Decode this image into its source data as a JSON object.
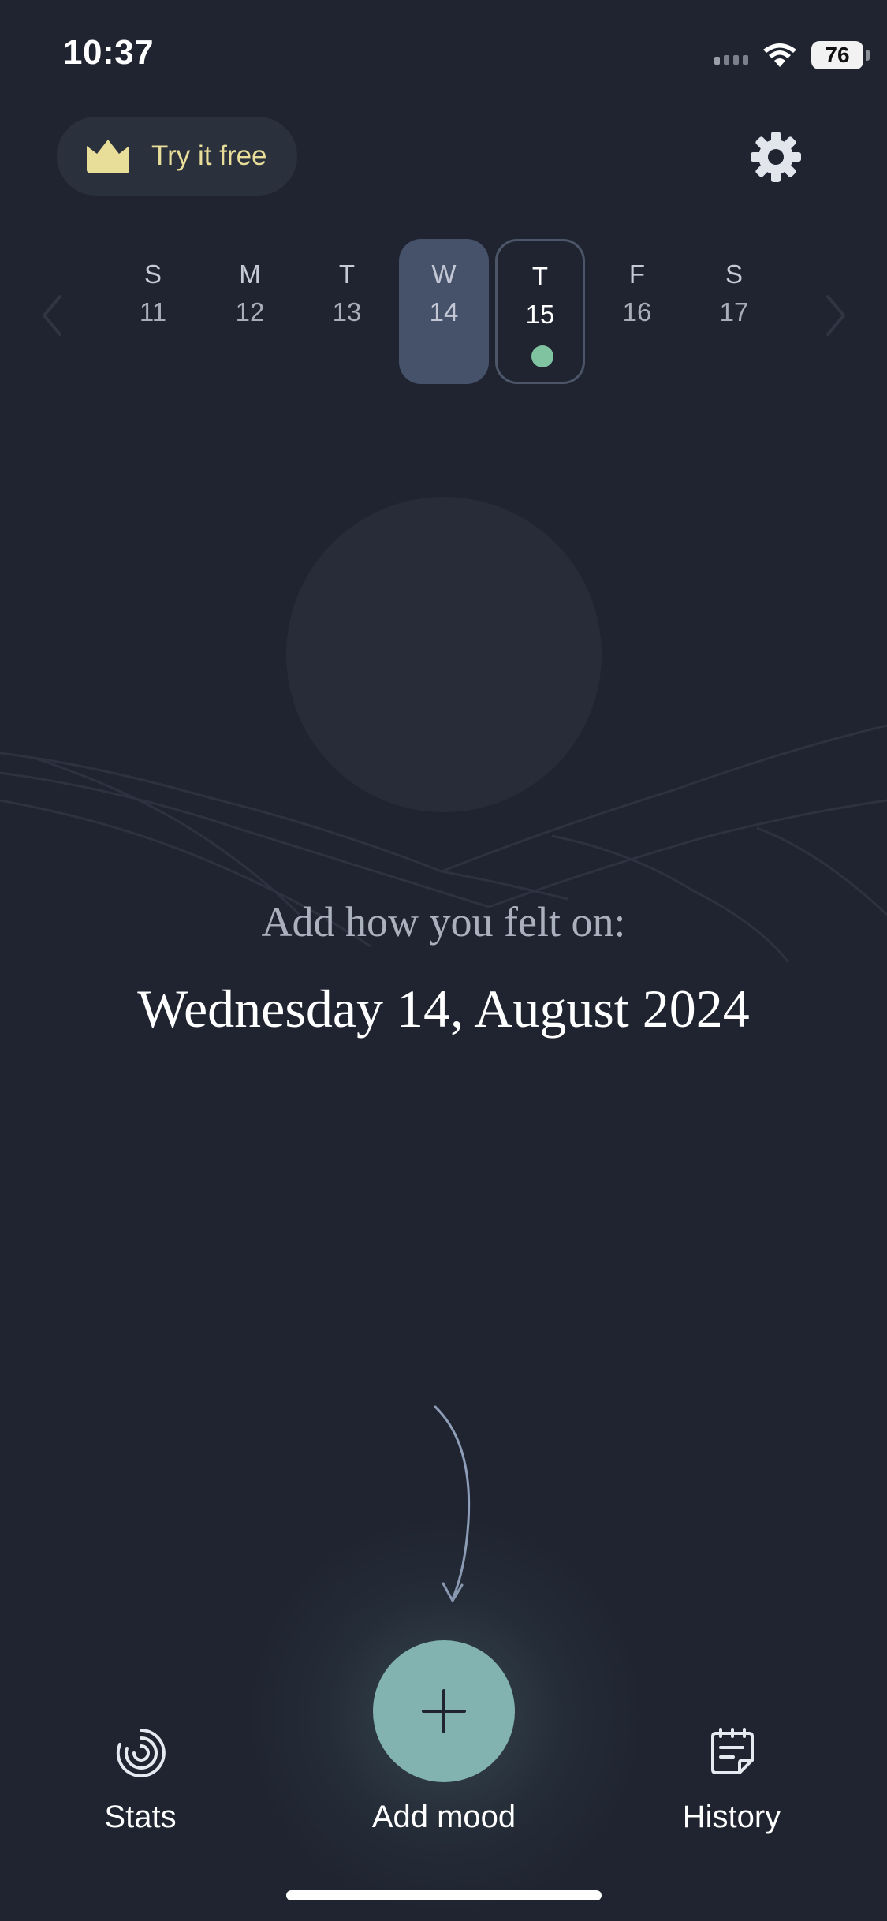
{
  "status_bar": {
    "time": "10:37",
    "battery": "76"
  },
  "header": {
    "promo_label": "Try it free",
    "icons": [
      "crown-icon",
      "gear-icon"
    ]
  },
  "week": {
    "days": [
      {
        "name": "S",
        "num": "11"
      },
      {
        "name": "M",
        "num": "12"
      },
      {
        "name": "T",
        "num": "13"
      },
      {
        "name": "W",
        "num": "14",
        "selected": true
      },
      {
        "name": "T",
        "num": "15",
        "today": true,
        "has_entry": true
      },
      {
        "name": "F",
        "num": "16"
      },
      {
        "name": "S",
        "num": "17"
      }
    ]
  },
  "main": {
    "prompt": "Add how you felt on:",
    "date": "Wednesday 14, August 2024"
  },
  "bottom_nav": {
    "stats_label": "Stats",
    "add_label": "Add mood",
    "history_label": "History"
  },
  "colors": {
    "background": "#1f2430",
    "accent": "#82b3b0",
    "promo_text": "#e8de9a",
    "entry_dot": "#7fc3a0"
  }
}
